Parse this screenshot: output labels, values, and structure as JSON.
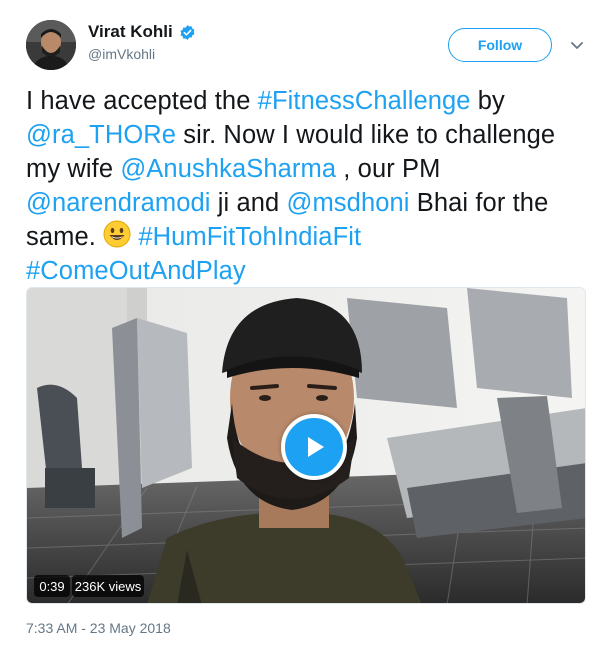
{
  "author": {
    "name": "Virat Kohli",
    "handle": "@imVkohli",
    "verified_icon": "verified-badge-icon"
  },
  "follow_label": "Follow",
  "tweet": {
    "segments": [
      {
        "text": "I have accepted the ",
        "link": false
      },
      {
        "text": "#FitnessChallenge",
        "link": true
      },
      {
        "text": " by ",
        "link": false
      },
      {
        "text": "@ra_THORe",
        "link": true
      },
      {
        "text": " sir. Now I would like to challenge my wife ",
        "link": false
      },
      {
        "text": "@AnushkaSharma",
        "link": true
      },
      {
        "text": " , our PM ",
        "link": false
      },
      {
        "text": "@narendramodi",
        "link": true
      },
      {
        "text": " ji and ",
        "link": false
      },
      {
        "text": "@msdhoni",
        "link": true
      },
      {
        "text": " Bhai for the same. ",
        "link": false
      },
      {
        "text": "😃",
        "emoji": true
      },
      {
        "text": " ",
        "link": false
      },
      {
        "text": "#HumFitTohIndiaFit",
        "link": true
      },
      {
        "text": " ",
        "link": false
      },
      {
        "text": "#ComeOutAndPlay",
        "link": true
      }
    ]
  },
  "video": {
    "duration": "0:39",
    "views": "236K views"
  },
  "timestamp": "7:33 AM - 23 May 2018",
  "colors": {
    "accent": "#1da1f2",
    "text": "#14171a",
    "muted": "#657786"
  }
}
